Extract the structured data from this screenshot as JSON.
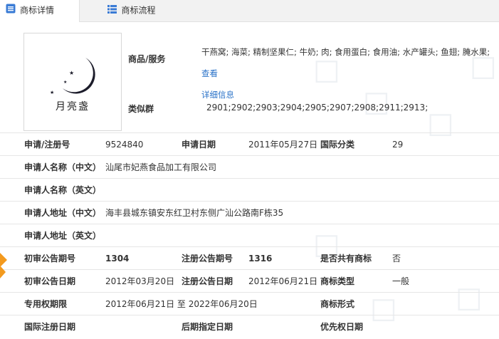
{
  "tabs": [
    {
      "label": "商标详情",
      "icon": "document-list-icon"
    },
    {
      "label": "商标流程",
      "icon": "flow-list-icon"
    }
  ],
  "logo": {
    "text": "月亮盏"
  },
  "goods": {
    "label": "商品/服务",
    "text": "干燕窝; 海菜; 精制坚果仁; 牛奶; 肉; 食用蛋白; 食用油; 水产罐头; 鱼翅; 腌水果;",
    "link_inline": "查看",
    "link_next": "详细信息"
  },
  "similar": {
    "label": "类似群",
    "value": "2901;2902;2903;2904;2905;2907;2908;2911;2913;"
  },
  "rows": [
    {
      "l1": "申请/注册号",
      "v1": "9524840",
      "l2": "申请日期",
      "v2": "2011年05月27日",
      "l3": "国际分类",
      "v3": "29"
    },
    {
      "l1": "申请人名称（中文）",
      "v1": "汕尾市妃燕食品加工有限公司"
    },
    {
      "l1": "申请人名称（英文）",
      "v1": ""
    },
    {
      "l1": "申请人地址（中文）",
      "v1": "海丰县城东镇安东红卫村东侧广汕公路南F栋35"
    },
    {
      "l1": "申请人地址（英文）",
      "v1": ""
    },
    {
      "l1": "初审公告期号",
      "v1": "1304",
      "l2": "注册公告期号",
      "v2": "1316",
      "l3": "是否共有商标",
      "v3": "否"
    },
    {
      "l1": "初审公告日期",
      "v1": "2012年03月20日",
      "l2": "注册公告日期",
      "v2": "2012年06月21日",
      "l3": "商标类型",
      "v3": "一般"
    },
    {
      "l1": "专用权期限",
      "v1": "2012年06月21日 至 2022年06月20日",
      "l3": "商标形式",
      "v3": ""
    },
    {
      "l1": "国际注册日期",
      "v1": "",
      "l2": "后期指定日期",
      "v2": "",
      "l3": "优先权日期",
      "v3": ""
    }
  ],
  "colors": {
    "link": "#2a72c8",
    "accent_orange": "#f39a1e",
    "tab_bg": "#f2f2f2"
  }
}
